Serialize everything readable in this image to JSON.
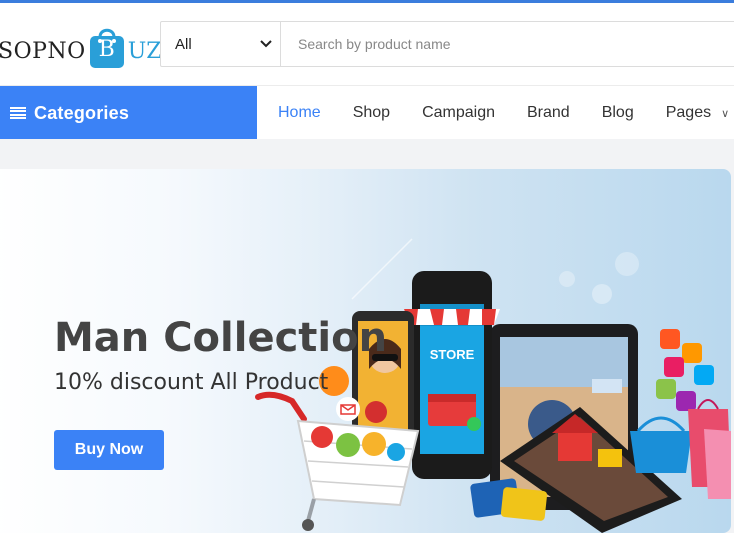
{
  "brand": {
    "name_part1": "SOPNO",
    "bag_letter": "B",
    "name_part2": "UZ",
    "accent_color": "#2a9fd8"
  },
  "search": {
    "category_selected": "All",
    "placeholder": "Search by product name"
  },
  "nav": {
    "categories_label": "Categories",
    "links": [
      "Home",
      "Shop",
      "Campaign",
      "Brand",
      "Blog",
      "Pages"
    ],
    "active": "Home",
    "primary_color": "#3b82f6"
  },
  "banner": {
    "title": "Man Collection",
    "subtitle": "10% discount All Product",
    "button_label": "Buy Now",
    "store_sign": "STORE"
  },
  "icons": [
    "hamburger-icon",
    "chevron-down-icon",
    "shopping-bag-icon",
    "shopping-cart-icon"
  ]
}
